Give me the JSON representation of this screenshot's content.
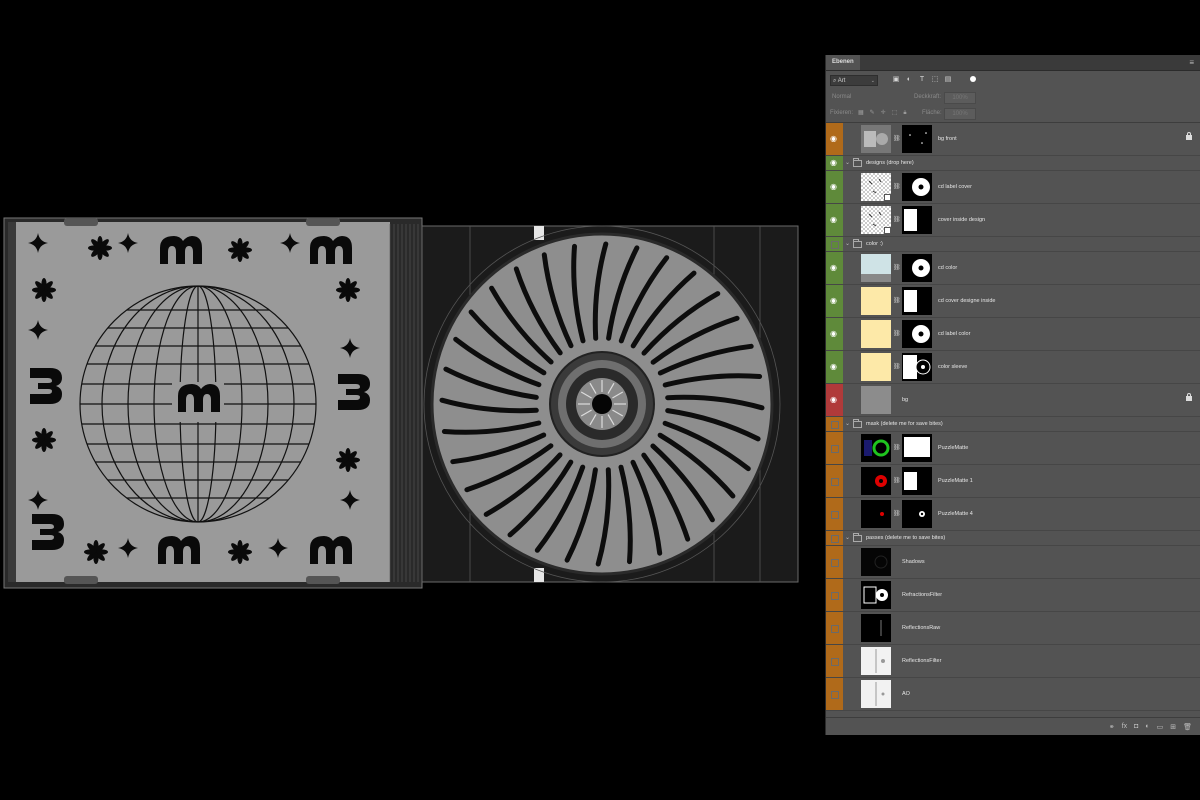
{
  "panel": {
    "tab_label": "Ebenen",
    "menu_icon": "panel-menu-icon",
    "filter": {
      "kind_value": "Art",
      "icons": [
        "image-filter-icon",
        "adjustment-filter-icon",
        "type-filter-icon",
        "shape-filter-icon",
        "smartobject-filter-icon"
      ]
    },
    "blend_mode": "Normal",
    "opacity_label": "Deckkraft:",
    "opacity_value": "100%",
    "lock_label": "Fixieren:",
    "fill_label": "Fläche:",
    "fill_value": "100%",
    "footer_icons": [
      "link-icon",
      "fx-icon",
      "mask-icon",
      "adjustment-icon",
      "folder-icon",
      "new-layer-icon",
      "trash-icon"
    ]
  },
  "layers": [
    {
      "name": "bg front",
      "kind": "layer",
      "color": "#b06a1a",
      "visible": true,
      "locked": true,
      "thumb": "bgfront",
      "mask": "dots"
    },
    {
      "name": "designs (drop here)",
      "kind": "group",
      "color": "#5f8a3a",
      "visible": true
    },
    {
      "name": "cd label cover",
      "kind": "layer",
      "color": "#5f8a3a",
      "visible": true,
      "thumb": "checker",
      "mask": "disc"
    },
    {
      "name": "cover inside design",
      "kind": "layer",
      "color": "#5f8a3a",
      "visible": true,
      "thumb": "checker",
      "mask": "square"
    },
    {
      "name": "color :)",
      "kind": "group",
      "color": "#5f8a3a",
      "visible": false
    },
    {
      "name": "cd color",
      "kind": "layer",
      "color": "#5f8a3a",
      "visible": true,
      "thumb": "lightblue",
      "mask": "disc"
    },
    {
      "name": "cd cover designe inside",
      "kind": "layer",
      "color": "#5f8a3a",
      "visible": true,
      "thumb": "yellow",
      "mask": "square"
    },
    {
      "name": "cd label color",
      "kind": "layer",
      "color": "#5f8a3a",
      "visible": true,
      "thumb": "yellow",
      "mask": "disc"
    },
    {
      "name": "color sleeve",
      "kind": "layer",
      "color": "#5f8a3a",
      "visible": true,
      "thumb": "yellow",
      "mask": "sleeve"
    },
    {
      "name": "bg",
      "kind": "layer",
      "color": "#b03a3a",
      "visible": true,
      "locked": true,
      "thumb": "grey",
      "mask": ""
    },
    {
      "name": "mask (delete me for save bites)",
      "kind": "group",
      "color": "#b06a1a",
      "visible": false
    },
    {
      "name": "PuzzleMatte",
      "kind": "layer",
      "color": "#b06a1a",
      "visible": false,
      "thumb": "puzzlegreen",
      "mask": "white"
    },
    {
      "name": "PuzzleMatte 1",
      "kind": "layer",
      "color": "#b06a1a",
      "visible": false,
      "thumb": "puzzlered",
      "mask": "whitesq"
    },
    {
      "name": "PuzzleMatte 4",
      "kind": "layer",
      "color": "#b06a1a",
      "visible": false,
      "thumb": "puzzlesmall",
      "mask": "whitedisc"
    },
    {
      "name": "passes (delete me to save bites)",
      "kind": "group",
      "color": "#b06a1a",
      "visible": false
    },
    {
      "name": "Shadows",
      "kind": "layer",
      "color": "#b06a1a",
      "visible": false,
      "thumb": "dark",
      "mask": ""
    },
    {
      "name": "RefractionsFilter",
      "kind": "layer",
      "color": "#b06a1a",
      "visible": false,
      "thumb": "refraction",
      "mask": ""
    },
    {
      "name": "ReflectionsRaw",
      "kind": "layer",
      "color": "#b06a1a",
      "visible": false,
      "thumb": "reflraw",
      "mask": ""
    },
    {
      "name": "ReflectionsFilter",
      "kind": "layer",
      "color": "#b06a1a",
      "visible": false,
      "thumb": "white",
      "mask": ""
    },
    {
      "name": "AO",
      "kind": "layer",
      "color": "#b06a1a",
      "visible": false,
      "thumb": "white2",
      "mask": ""
    }
  ]
}
